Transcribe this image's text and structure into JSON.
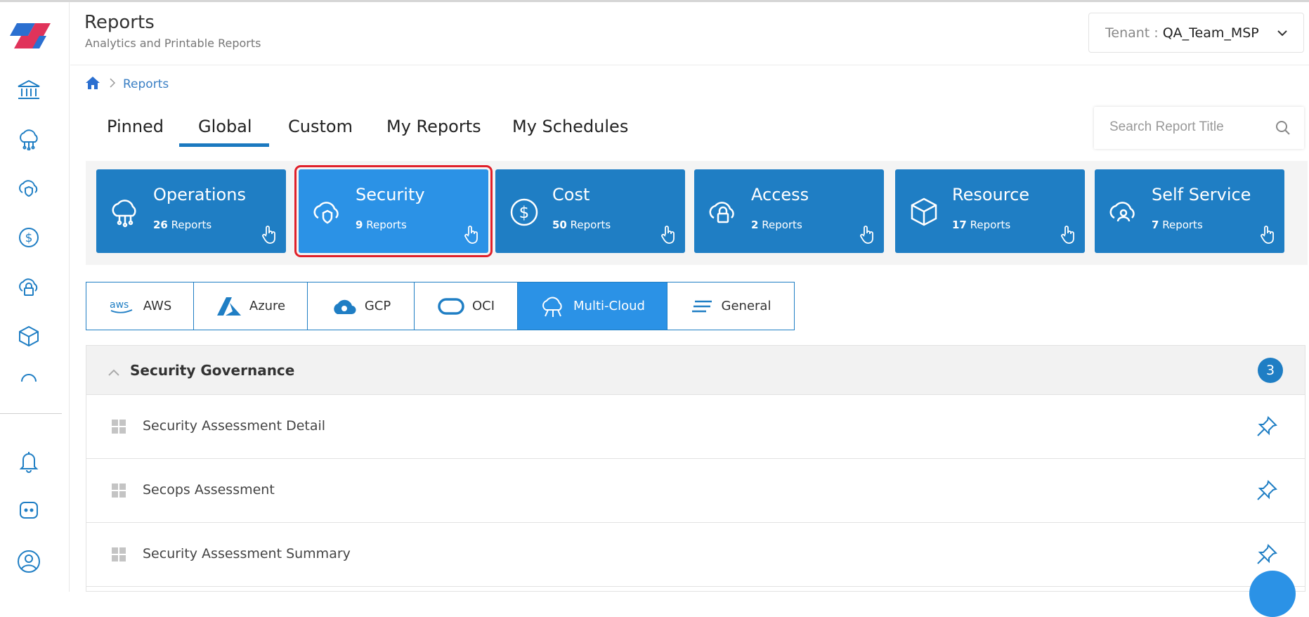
{
  "header": {
    "title": "Reports",
    "subtitle": "Analytics and Printable Reports",
    "tenant_label": "Tenant :",
    "tenant_value": "QA_Team_MSP"
  },
  "breadcrumb": {
    "current": "Reports"
  },
  "tabs": [
    {
      "label": "Pinned"
    },
    {
      "label": "Global",
      "active": true
    },
    {
      "label": "Custom"
    },
    {
      "label": "My Reports"
    },
    {
      "label": "My Schedules"
    }
  ],
  "search": {
    "placeholder": "Search Report Title"
  },
  "categories": [
    {
      "title": "Operations",
      "count": "26",
      "suffix": "Reports",
      "icon": "cloud-network-icon"
    },
    {
      "title": "Security",
      "count": "9",
      "suffix": "Reports",
      "icon": "cloud-shield-icon",
      "active": true
    },
    {
      "title": "Cost",
      "count": "50",
      "suffix": "Reports",
      "icon": "dollar-icon"
    },
    {
      "title": "Access",
      "count": "2",
      "suffix": "Reports",
      "icon": "cloud-lock-icon"
    },
    {
      "title": "Resource",
      "count": "17",
      "suffix": "Reports",
      "icon": "cube-icon"
    },
    {
      "title": "Self Service",
      "count": "7",
      "suffix": "Reports",
      "icon": "cloud-user-icon"
    }
  ],
  "providers": [
    {
      "label": "AWS",
      "icon": "aws-logo-icon"
    },
    {
      "label": "Azure",
      "icon": "azure-logo-icon"
    },
    {
      "label": "GCP",
      "icon": "gcp-logo-icon"
    },
    {
      "label": "OCI",
      "icon": "oci-logo-icon"
    },
    {
      "label": "Multi-Cloud",
      "icon": "multi-cloud-icon",
      "active": true
    },
    {
      "label": "General",
      "icon": "general-lines-icon"
    }
  ],
  "section": {
    "title": "Security Governance",
    "count": "3",
    "items": [
      {
        "label": "Security Assessment Detail"
      },
      {
        "label": "Secops Assessment"
      },
      {
        "label": "Security Assessment Summary"
      }
    ]
  },
  "colors": {
    "accent": "#1f7ec4",
    "active_card": "#2b92e6",
    "highlight_border": "#e0202a"
  }
}
